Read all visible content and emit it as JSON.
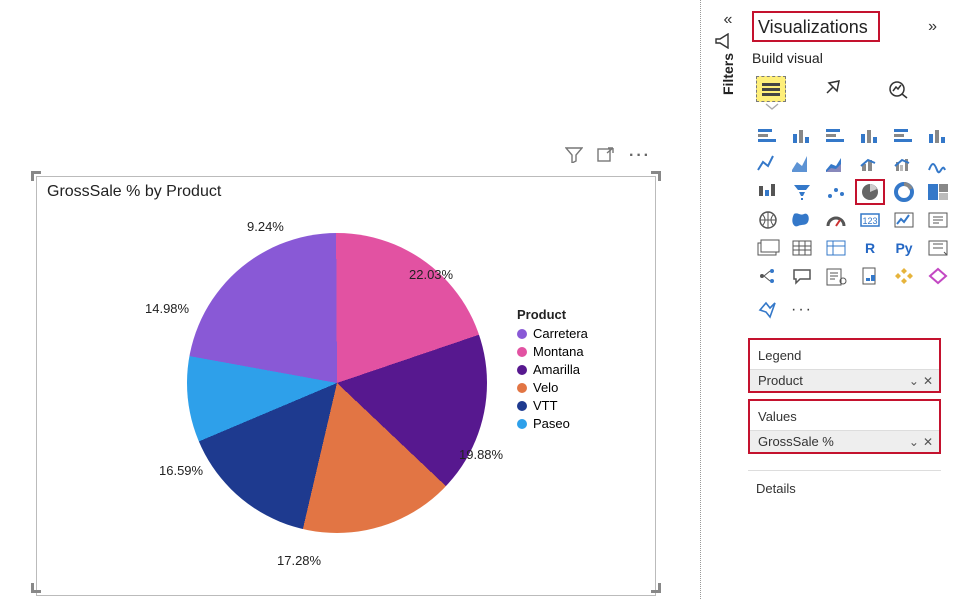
{
  "filters_label": "Filters",
  "visualizations_label": "Visualizations",
  "build_visual_label": "Build visual",
  "chart_title": "GrossSale % by Product",
  "legend_title": "Product",
  "field_wells": {
    "legend": {
      "name": "Legend",
      "value": "Product"
    },
    "values": {
      "name": "Values",
      "value": "GrossSale %"
    }
  },
  "details_label": "Details",
  "legend_items": [
    {
      "label": "Carretera",
      "color": "#8959d6"
    },
    {
      "label": "Montana",
      "color": "#e252a2"
    },
    {
      "label": "Amarilla",
      "color": "#57188f"
    },
    {
      "label": "Velo",
      "color": "#e27544"
    },
    {
      "label": "VTT",
      "color": "#1e3a8f"
    },
    {
      "label": "Paseo",
      "color": "#2ea0ea"
    }
  ],
  "data_labels": {
    "d0": "22.03%",
    "d1": "19.88%",
    "d2": "17.28%",
    "d3": "16.59%",
    "d4": "14.98%",
    "d5": "9.24%"
  },
  "viz_icons": [
    "stacked-bar-h",
    "stacked-bar-v",
    "clustered-bar-h",
    "clustered-bar-v",
    "100pct-bar-h",
    "100pct-bar-v",
    "line",
    "area",
    "stacked-area",
    "line-col",
    "line-col2",
    "ribbon",
    "waterfall",
    "funnel",
    "scatter",
    "pie",
    "donut",
    "treemap",
    "map",
    "filled-map",
    "gauge",
    "card",
    "kpi",
    "slicer",
    "multicard",
    "table",
    "matrix",
    "r",
    "py",
    "keyinf",
    "decomp",
    "qna",
    "narrative",
    "paginated",
    "appsource",
    "getmore"
  ],
  "chart_data": {
    "type": "pie",
    "title": "GrossSale % by Product",
    "categories": [
      "Carretera",
      "Montana",
      "Amarilla",
      "Velo",
      "VTT",
      "Paseo"
    ],
    "values": [
      22.03,
      19.88,
      17.28,
      16.59,
      14.98,
      9.24
    ],
    "colors": [
      "#8959d6",
      "#e252a2",
      "#57188f",
      "#e27544",
      "#1e3a8f",
      "#2ea0ea"
    ],
    "legend_position": "right",
    "value_label_suffix": "%"
  }
}
